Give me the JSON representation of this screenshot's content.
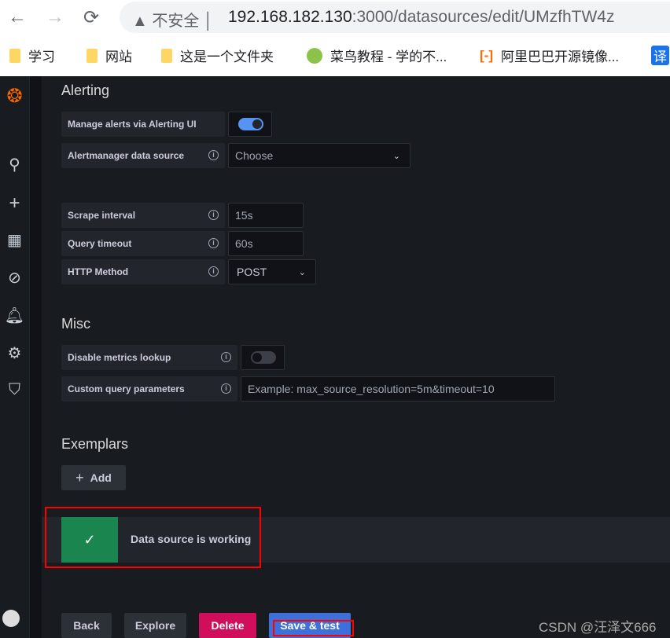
{
  "browser": {
    "insecure_label": "不安全",
    "url_host": "192.168.182.130",
    "url_rest": ":3000/datasources/edit/UMzfhTW4z",
    "bookmarks": [
      "学习",
      "网站",
      "这是一个文件夹",
      "菜鸟教程 - 学的不...",
      "阿里巴巴开源镜像...",
      "译"
    ]
  },
  "sidebar": {
    "icons": [
      "grafana-logo",
      "search-icon",
      "plus-icon",
      "dashboards-icon",
      "explore-icon",
      "bell-icon",
      "gear-icon",
      "shield-icon",
      "avatar"
    ]
  },
  "alerting": {
    "title": "Alerting",
    "manage_label": "Manage alerts via Alerting UI",
    "manage_enabled": true,
    "am_label": "Alertmanager data source",
    "am_placeholder": "Choose"
  },
  "query": {
    "scrape_label": "Scrape interval",
    "scrape_placeholder": "15s",
    "timeout_label": "Query timeout",
    "timeout_placeholder": "60s",
    "method_label": "HTTP Method",
    "method_value": "POST"
  },
  "misc": {
    "title": "Misc",
    "disable_label": "Disable metrics lookup",
    "disable_enabled": false,
    "custom_label": "Custom query parameters",
    "custom_placeholder": "Example: max_source_resolution=5m&timeout=10"
  },
  "exemplars": {
    "title": "Exemplars",
    "add_label": "Add"
  },
  "alert": {
    "message": "Data source is working",
    "color": "#1b8550"
  },
  "buttons": {
    "back": "Back",
    "explore": "Explore",
    "delete": "Delete",
    "save": "Save & test"
  },
  "watermark": "CSDN @汪泽文666",
  "colors": {
    "accent": "#3d71d9",
    "danger": "#d10e5c",
    "highlight": "#ff0000"
  }
}
